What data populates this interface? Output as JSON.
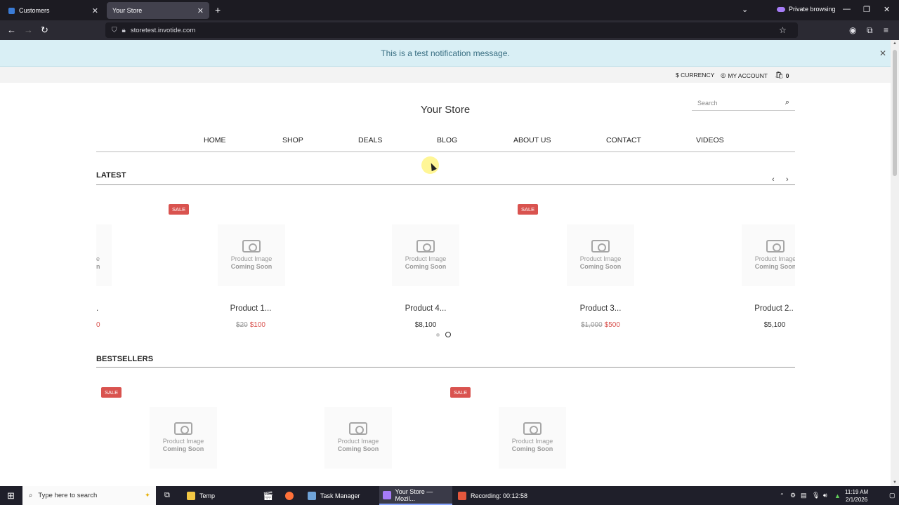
{
  "browser": {
    "tabs": [
      {
        "title": "Customers",
        "active": false
      },
      {
        "title": "Your Store",
        "active": true
      }
    ],
    "private_label": "Private browsing",
    "url": "storetest.invotide.com"
  },
  "notification": {
    "message": "This is a test notification message."
  },
  "topbar": {
    "currency": "$ CURRENCY",
    "account": "MY ACCOUNT",
    "cart_count": "0"
  },
  "header": {
    "store_name": "Your Store",
    "search_placeholder": "Search"
  },
  "menu": [
    "HOME",
    "SHOP",
    "DEALS",
    "BLOG",
    "ABOUT US",
    "CONTACT",
    "VIDEOS"
  ],
  "sections": {
    "latest": "LATEST",
    "bestsellers": "BESTSELLERS"
  },
  "image_placeholder": {
    "line1": "Product Image",
    "line2": "Coming Soon"
  },
  "sale_badge": "SALE",
  "latest_products": [
    {
      "name": "Product 1...",
      "old_price": "$20",
      "price": "$100",
      "sale": true
    },
    {
      "name": "Product 4...",
      "old_price": "",
      "price": "$8,100",
      "sale": false
    },
    {
      "name": "Product 3...",
      "old_price": "$1,000",
      "price": "$500",
      "sale": true
    },
    {
      "name": "Product 2..",
      "old_price": "",
      "price": "$5,100",
      "sale": false
    }
  ],
  "partial_price": "0",
  "partial_name": ".",
  "partial_image": {
    "line1": "e",
    "line2": "n"
  },
  "taskbar": {
    "search_placeholder": "Type here to search",
    "items": [
      "Temp",
      "Task Manager",
      "Your Store — Mozil...",
      "Recording:  00:12:58"
    ],
    "time": "11:19 AM",
    "date": "2/1/2026"
  },
  "colors": {
    "sale": "#d9534f",
    "notice_bg": "#d9eff5",
    "notice_text": "#3a6f83",
    "taskbar": "#1f1f2a"
  }
}
